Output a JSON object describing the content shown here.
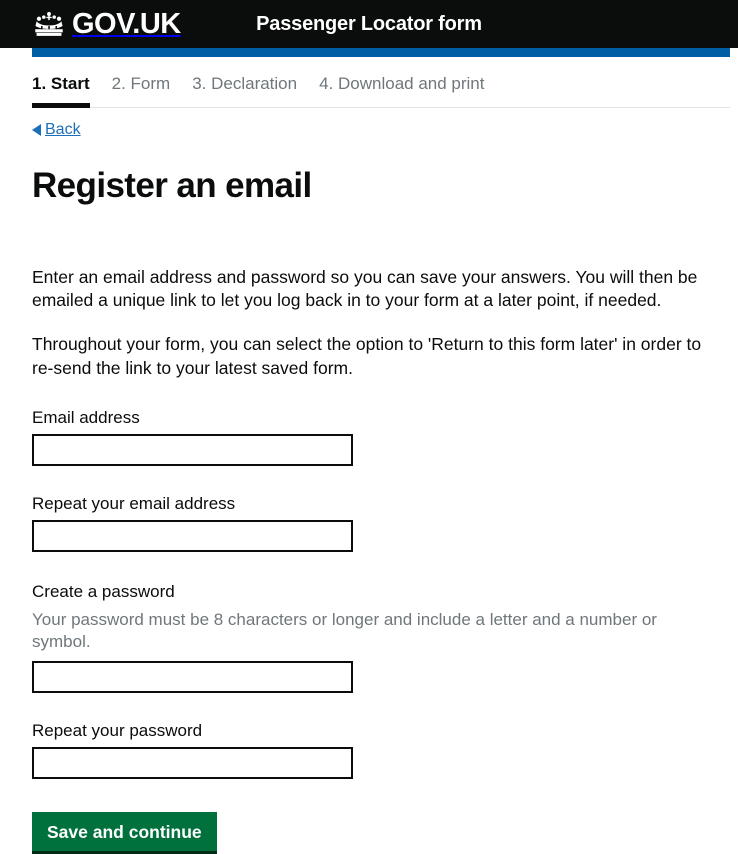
{
  "header": {
    "brand_name": "GOV.UK",
    "crown_icon": "crown-icon",
    "service_name": "Passenger Locator form"
  },
  "phase_bar": {
    "color": "#005ea5"
  },
  "step_nav": {
    "items": [
      {
        "label": "1. Start",
        "active": true
      },
      {
        "label": "2. Form",
        "active": false
      },
      {
        "label": "3. Declaration",
        "active": false
      },
      {
        "label": "4. Download and print",
        "active": false
      }
    ]
  },
  "back_link": {
    "icon": "left-triangle-icon",
    "label": "Back"
  },
  "main": {
    "heading": "Register an email",
    "paragraphs": [
      "Enter an email address and password so you can save your answers. You will then be emailed a unique link to let you log back in to your form at a later point, if needed.",
      "Throughout your form, you can select the option to 'Return to this form later' in order to re-send the link to your latest saved form."
    ],
    "fields": [
      {
        "label": "Email address",
        "hint": "",
        "value": "",
        "placeholder": ""
      },
      {
        "label": "Repeat your email address",
        "hint": "",
        "value": "",
        "placeholder": ""
      },
      {
        "label": "Create a password",
        "hint": "Your password must be 8 characters or longer and include a letter and a number or symbol.",
        "value": "",
        "placeholder": ""
      },
      {
        "label": "Repeat your password",
        "hint": "",
        "value": "",
        "placeholder": ""
      }
    ],
    "submit_label": "Save and continue"
  },
  "colors": {
    "header_background": "#0b0c0c",
    "phase_blue": "#005ea5",
    "link_blue": "#1d70b8",
    "button_green": "#00703c",
    "hint_grey": "#6f777b",
    "text_black": "#0b0c0c"
  }
}
